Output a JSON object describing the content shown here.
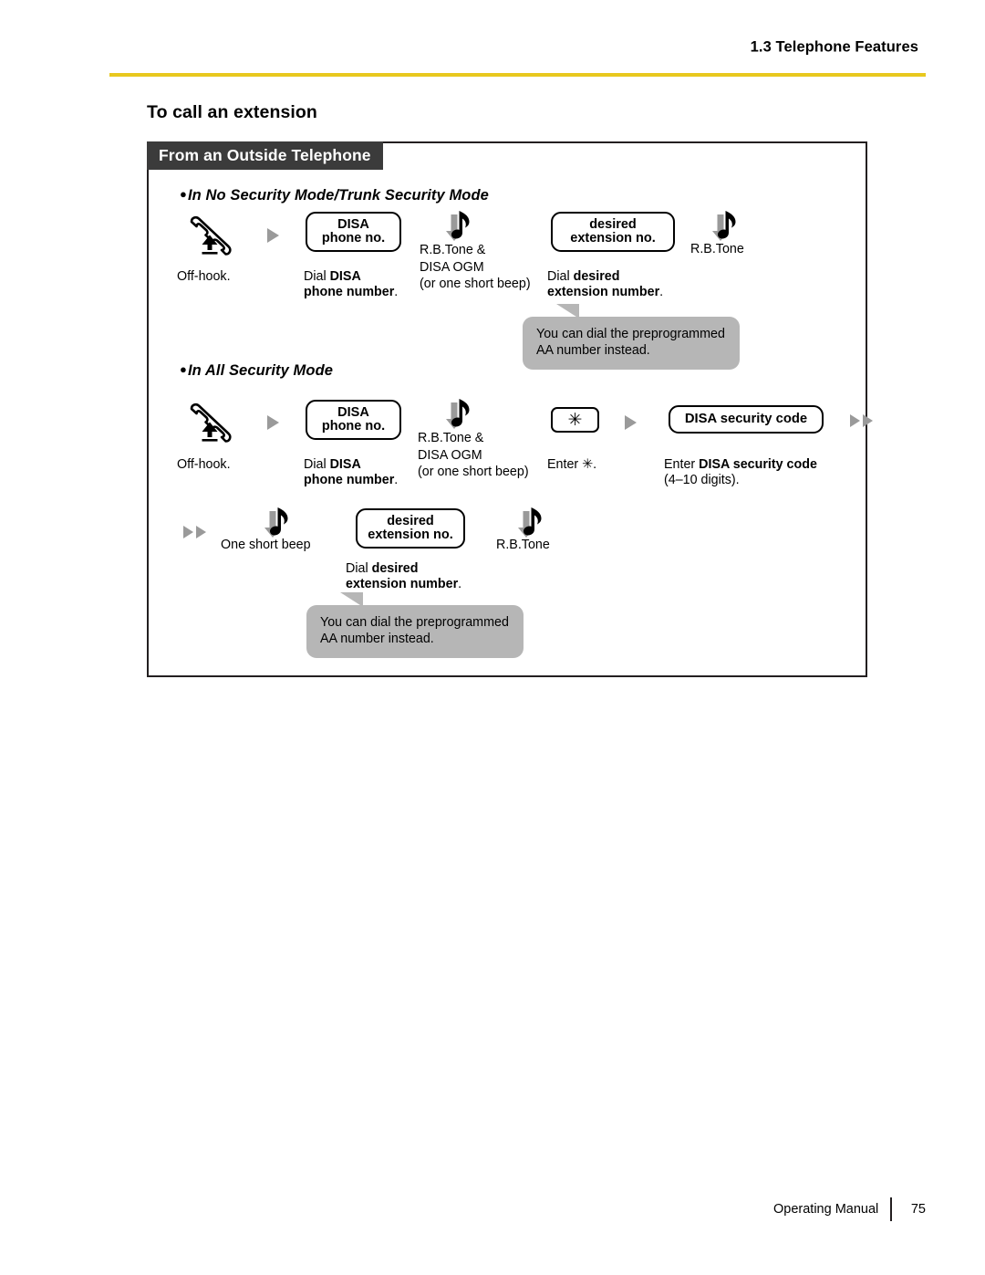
{
  "header": {
    "title": "1.3 Telephone Features",
    "rule_color": "#e8c81e"
  },
  "section": {
    "title": "To call an extension"
  },
  "panel": {
    "banner": "From an Outside Telephone",
    "banner_bg": "#3b3b3b",
    "border_color": "#231f20"
  },
  "modes": [
    {
      "id": "no-security",
      "bullet": "●",
      "heading": "In No Security Mode/Trunk Security Mode",
      "steps": [
        {
          "icon": "offhook-handset-icon",
          "caption": "Off-hook."
        },
        {
          "icon": "step-arrow-icon"
        },
        {
          "token": {
            "line1": "DISA",
            "line2": "phone no."
          },
          "caption_plain": "Dial ",
          "caption_bold": "DISA",
          "caption_line2_bold": "phone number",
          "caption_line2_tail": "."
        },
        {
          "icon": "tone-icon",
          "tone_label_line1": "R.B.Tone &",
          "tone_label_line2": "DISA OGM",
          "tone_label_line3": "(or one short beep)"
        },
        {
          "token": {
            "line1": "desired",
            "line2": "extension no."
          },
          "caption_plain": "Dial ",
          "caption_bold": "desired",
          "caption_line2_bold": "extension number",
          "caption_line2_tail": "."
        },
        {
          "icon": "tone-icon",
          "tone_label_line1": "R.B.Tone"
        }
      ],
      "bubble": {
        "line1": "You can dial the preprogrammed",
        "line2": "AA number instead.",
        "bg": "#b6b6b6"
      }
    },
    {
      "id": "all-security",
      "bullet": "●",
      "heading": "In All Security Mode",
      "steps": [
        {
          "icon": "offhook-handset-icon",
          "caption": "Off-hook."
        },
        {
          "icon": "step-arrow-icon"
        },
        {
          "token": {
            "line1": "DISA",
            "line2": "phone no."
          },
          "caption_plain": "Dial ",
          "caption_bold": "DISA",
          "caption_line2_bold": "phone number",
          "caption_line2_tail": "."
        },
        {
          "icon": "tone-icon",
          "tone_label_line1": "R.B.Tone &",
          "tone_label_line2": "DISA OGM",
          "tone_label_line3": "(or one short beep)"
        },
        {
          "keycap": "✳",
          "caption_plain": "Enter ",
          "caption_glyph": "✳",
          "caption_tail": "."
        },
        {
          "icon": "step-arrow-icon"
        },
        {
          "token": {
            "line1": "DISA security code"
          },
          "caption_plain": "Enter ",
          "caption_bold": "DISA security code",
          "caption_line2": "(4–10 digits)."
        },
        {
          "icon": "double-arrow-icon"
        }
      ],
      "steps_row2": [
        {
          "icon": "double-arrow-icon"
        },
        {
          "icon": "tone-icon",
          "tone_label_line1": "One short beep"
        },
        {
          "token": {
            "line1": "desired",
            "line2": "extension no."
          },
          "caption_plain": "Dial ",
          "caption_bold": "desired",
          "caption_line2_bold": "extension number",
          "caption_line2_tail": "."
        },
        {
          "icon": "tone-icon",
          "tone_label_line1": "R.B.Tone"
        }
      ],
      "bubble": {
        "line1": "You can dial the preprogrammed",
        "line2": "AA number instead.",
        "bg": "#b6b6b6"
      }
    }
  ],
  "footer": {
    "manual": "Operating Manual",
    "page": "75"
  }
}
